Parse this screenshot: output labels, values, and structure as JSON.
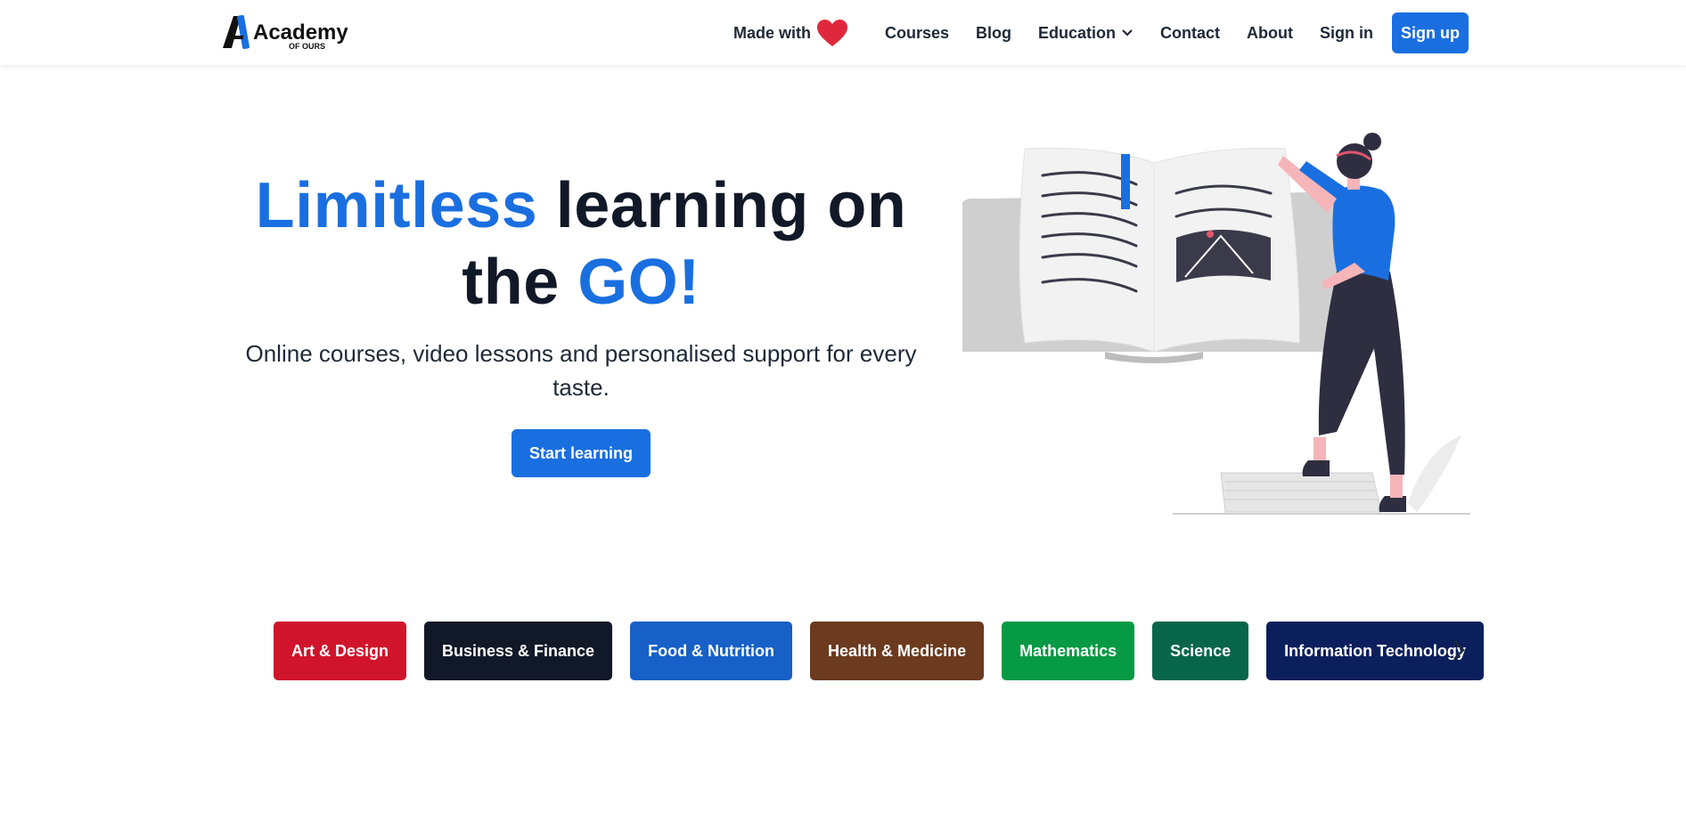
{
  "brand": {
    "logo_main": "Academy",
    "logo_sub": "OF OURS",
    "accent": "#1a6fe0"
  },
  "nav": {
    "made_with": "Made with",
    "items": [
      "Courses",
      "Blog",
      "Education",
      "Contact",
      "About",
      "Sign in"
    ],
    "signup": "Sign up"
  },
  "hero": {
    "title_accent_1": "Limitless",
    "title_rest_1": " learning on",
    "title_rest_2": "the ",
    "title_accent_2": "GO!",
    "subtitle": "Online courses, video lessons and personalised support for every taste.",
    "cta": "Start learning"
  },
  "categories": [
    {
      "label": "Art & Design",
      "color": "#d0142c"
    },
    {
      "label": "Business & Finance",
      "color": "#111827"
    },
    {
      "label": "Food & Nutrition",
      "color": "#1660c7"
    },
    {
      "label": "Health & Medicine",
      "color": "#6b3a1f"
    },
    {
      "label": "Mathematics",
      "color": "#079a44"
    },
    {
      "label": "Science",
      "color": "#076649"
    },
    {
      "label": "Information Technology",
      "color": "#0b1f5c"
    }
  ]
}
